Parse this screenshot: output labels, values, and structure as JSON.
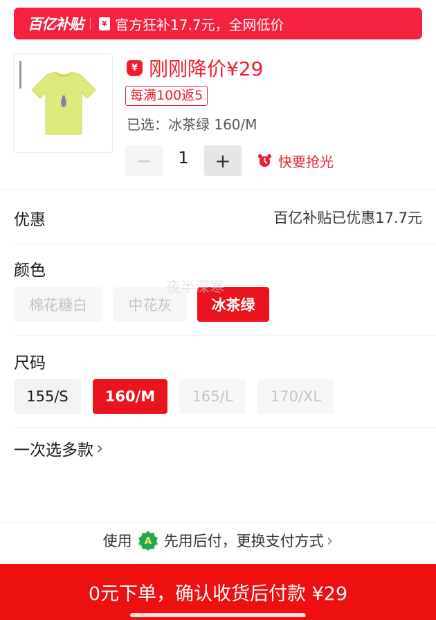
{
  "banner": {
    "logo": "百亿补贴",
    "icon_glyph": "¥",
    "text": "官方狂补17.7元，全网低价"
  },
  "product": {
    "image_alt": "冰茶绿 T恤",
    "price_icon_glyph": "¥",
    "price_text": "刚刚降价¥29",
    "promo_tag": "每满100返5",
    "selected": "已选：冰茶绿 160/M",
    "quantity": {
      "minus": "−",
      "value": "1",
      "plus": "+"
    },
    "hurry_text": "快要抢光"
  },
  "discount": {
    "label": "优惠",
    "value": "百亿补贴已优惠17.7元"
  },
  "color": {
    "label": "颜色",
    "options": [
      "棉花糖白",
      "中花灰",
      "冰茶绿"
    ],
    "selected": "冰茶绿",
    "watermark": "夜半深寒"
  },
  "size": {
    "label": "尺码",
    "options": [
      "155/S",
      "160/M",
      "165/L",
      "170/XL"
    ],
    "selected": "160/M"
  },
  "multi_select": {
    "label": "一次选多款",
    "chevron": "›"
  },
  "payment": {
    "prefix": "使用",
    "icon_glyph": "A",
    "text": "先用后付，更换支付方式",
    "chevron": "›"
  },
  "footer": {
    "button_label": "0元下单，确认收货后付款 ¥29"
  },
  "colors": {
    "brand_red": "#f5223f",
    "price_red": "#ef1d2c",
    "button_red": "#ee1010",
    "pay_green": "#1faa4d"
  }
}
